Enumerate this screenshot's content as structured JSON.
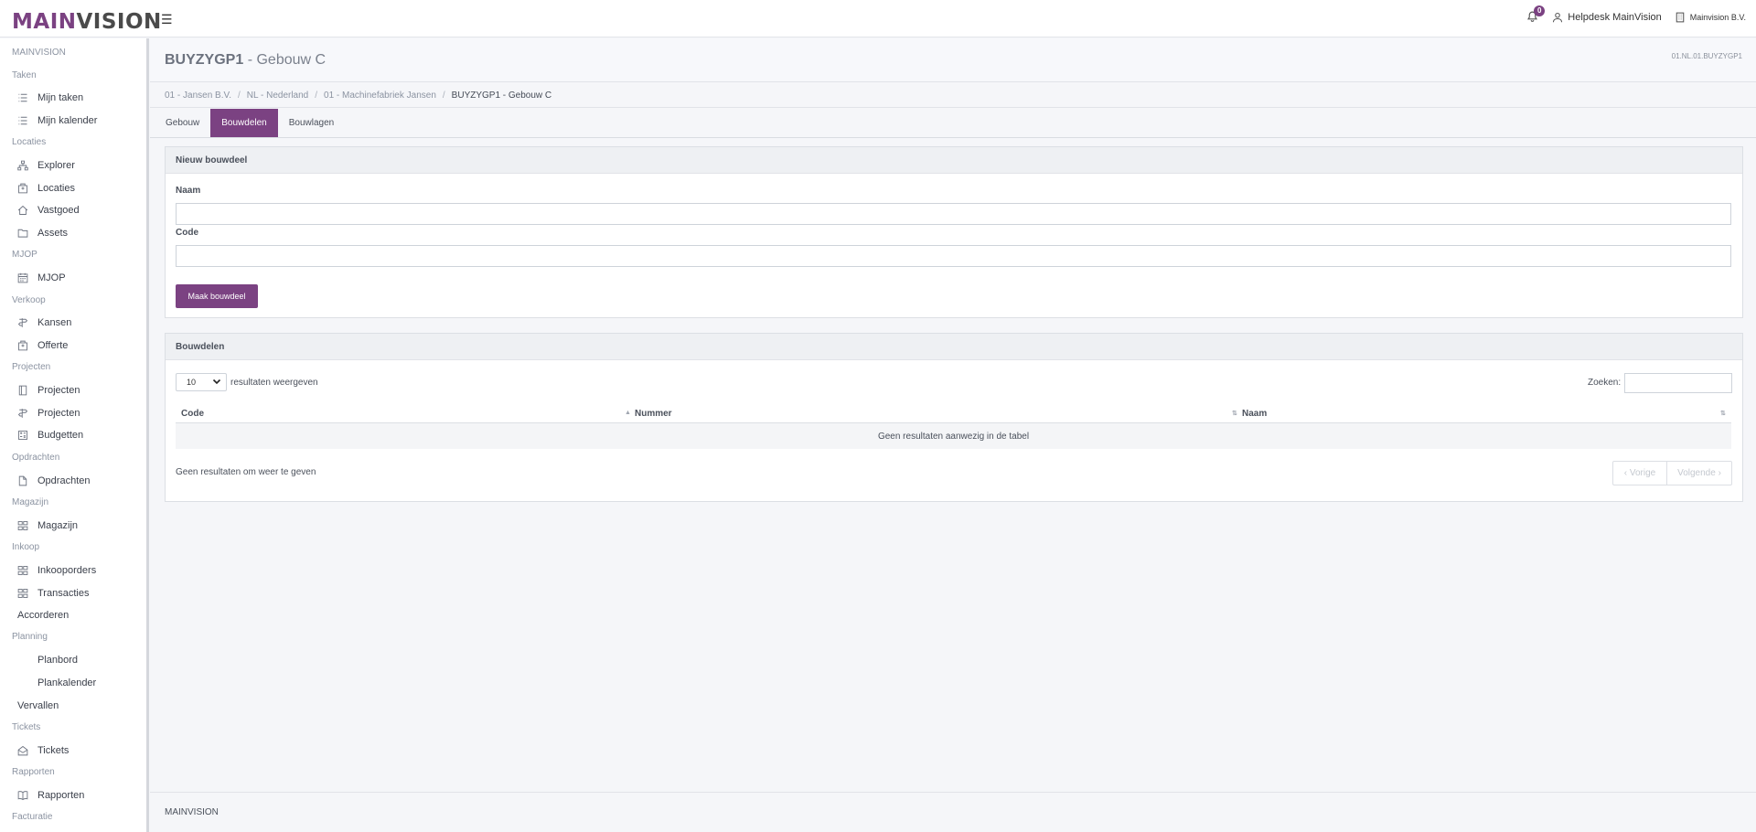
{
  "brand": {
    "main": "MAIN",
    "vision": "VISION",
    "accent": "#7b4282"
  },
  "topbar": {
    "notifications_count": "0",
    "user_name": "Helpdesk MainVision",
    "company": "Mainvision B.V."
  },
  "sidebar": {
    "brand_label": "MAINVISION",
    "groups": [
      {
        "title": "Taken",
        "items": [
          {
            "label": "Mijn taken",
            "icon": "list-icon"
          },
          {
            "label": "Mijn kalender",
            "icon": "list-icon"
          }
        ]
      },
      {
        "title": "Locaties",
        "items": [
          {
            "label": "Explorer",
            "icon": "sitemap-icon"
          },
          {
            "label": "Locaties",
            "icon": "building-icon"
          },
          {
            "label": "Vastgoed",
            "icon": "home-icon"
          },
          {
            "label": "Assets",
            "icon": "folder-icon"
          }
        ]
      },
      {
        "title": "MJOP",
        "items": [
          {
            "label": "MJOP",
            "icon": "calendar-icon"
          }
        ]
      },
      {
        "title": "Verkoop",
        "items": [
          {
            "label": "Kansen",
            "icon": "signpost-icon"
          },
          {
            "label": "Offerte",
            "icon": "building-icon"
          }
        ]
      },
      {
        "title": "Projecten",
        "items": [
          {
            "label": "Projecten",
            "icon": "book-icon"
          },
          {
            "label": "Projecten",
            "icon": "signpost-icon"
          },
          {
            "label": "Budgetten",
            "icon": "calculator-icon"
          }
        ]
      },
      {
        "title": "Opdrachten",
        "items": [
          {
            "label": "Opdrachten",
            "icon": "file-icon"
          }
        ]
      },
      {
        "title": "Magazijn",
        "items": [
          {
            "label": "Magazijn",
            "icon": "grid-icon"
          }
        ]
      },
      {
        "title": "Inkoop",
        "items": [
          {
            "label": "Inkooporders",
            "icon": "grid-icon"
          },
          {
            "label": "Transacties",
            "icon": "grid-icon"
          }
        ]
      },
      {
        "title": "",
        "items": [
          {
            "label": "Accorderen",
            "icon": ""
          }
        ]
      },
      {
        "title": "Planning",
        "items": [
          {
            "label": "Planbord",
            "icon": "none"
          },
          {
            "label": "Plankalender",
            "icon": "none"
          }
        ]
      },
      {
        "title": "",
        "items": [
          {
            "label": "Vervallen",
            "icon": ""
          }
        ]
      },
      {
        "title": "Tickets",
        "items": [
          {
            "label": "Tickets",
            "icon": "envelope-open-icon"
          }
        ]
      },
      {
        "title": "Rapporten",
        "items": [
          {
            "label": "Rapporten",
            "icon": "book-open-icon"
          }
        ]
      },
      {
        "title": "Facturatie",
        "items": []
      }
    ]
  },
  "header": {
    "title_code": "BUYZYGP1",
    "title_rest": "- Gebouw C",
    "code": "01.NL.01.BUYZYGP1"
  },
  "breadcrumb": [
    "01 - Jansen B.V.",
    "NL - Nederland",
    "01 - Machinefabriek Jansen",
    "BUYZYGP1 - Gebouw C"
  ],
  "tabs": [
    {
      "label": "Gebouw",
      "active": false
    },
    {
      "label": "Bouwdelen",
      "active": true
    },
    {
      "label": "Bouwlagen",
      "active": false
    }
  ],
  "new_panel": {
    "title": "Nieuw bouwdeel",
    "name_label": "Naam",
    "name_value": "",
    "code_label": "Code",
    "code_value": "",
    "submit_label": "Maak bouwdeel"
  },
  "list_panel": {
    "title": "Bouwdelen",
    "page_length": "10",
    "length_label": "resultaten weergeven",
    "search_label": "Zoeken:",
    "search_value": "",
    "columns": [
      "Code",
      "Nummer",
      "Naam"
    ],
    "empty_text": "Geen resultaten aanwezig in de tabel",
    "info_text": "Geen resultaten om weer te geven",
    "prev_label": "‹ Vorige",
    "next_label": "Volgende ›"
  },
  "footer": {
    "text": "MAINVISION"
  }
}
